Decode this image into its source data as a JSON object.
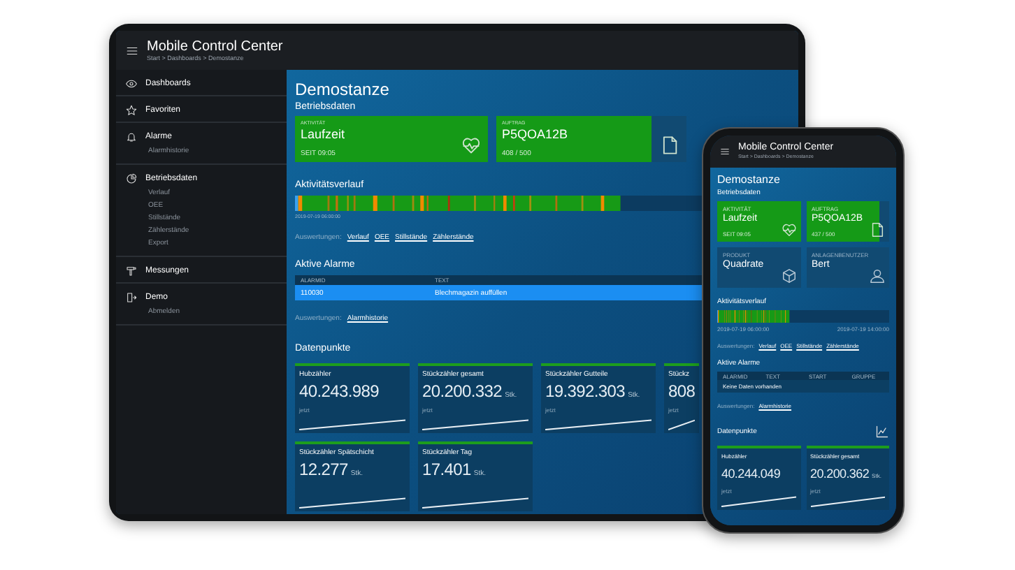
{
  "tablet": {
    "header": {
      "title": "Mobile Control Center",
      "breadcrumb": "Start > Dashboards > Demostanze"
    },
    "sidebar": {
      "items": [
        {
          "label": "Dashboards"
        },
        {
          "label": "Favoriten"
        },
        {
          "label": "Alarme",
          "children": [
            {
              "label": "Alarmhistorie"
            }
          ]
        },
        {
          "label": "Betriebsdaten",
          "children": [
            {
              "label": "Verlauf"
            },
            {
              "label": "OEE"
            },
            {
              "label": "Stillstände"
            },
            {
              "label": "Zählerstände"
            },
            {
              "label": "Export"
            }
          ]
        },
        {
          "label": "Messungen"
        },
        {
          "label": "Demo",
          "children": [
            {
              "label": "Abmelden"
            }
          ]
        }
      ]
    },
    "main": {
      "title": "Demostanze",
      "section": "Betriebsdaten",
      "cards": [
        {
          "kind": "status",
          "caption": "AKTIVITÄT",
          "value": "Laufzeit",
          "detail": "SEIT 09:05"
        },
        {
          "kind": "progress",
          "caption": "AUFTRAG",
          "value": "P5QOA12B",
          "detail": "408 / 500",
          "level": 0.816
        }
      ],
      "activity": {
        "title": "Aktivitätsverlauf",
        "dates": [
          "2019-07-19 06:00:00"
        ]
      },
      "activity_links": {
        "label": "Auswertungen:",
        "links": [
          "Verlauf",
          "OEE",
          "Stillstände",
          "Zählerstände"
        ]
      },
      "alarms": {
        "title": "Aktive Alarme",
        "columns": [
          "ALARMID",
          "TEXT"
        ],
        "rows": [
          {
            "cells": [
              "110030",
              "Blechmagazin auffüllen"
            ],
            "selected": true
          }
        ]
      },
      "alarm_links": {
        "label": "Auswertungen:",
        "links": [
          "Alarmhistorie"
        ]
      },
      "datapoints": {
        "title": "Datenpunkte",
        "items": [
          {
            "title": "Hubzähler",
            "value": "40.243.989",
            "time": "jetzt"
          },
          {
            "title": "Stückzähler gesamt",
            "value": "20.200.332",
            "unit": "Stk.",
            "time": "jetzt"
          },
          {
            "title": "Stückzähler Gutteile",
            "value": "19.392.303",
            "unit": "Stk.",
            "time": "jetzt"
          },
          {
            "title": "Stückz",
            "value": "808",
            "time": "jetzt"
          },
          {
            "title": "Stückzähler Spätschicht",
            "value": "12.277",
            "unit": "Stk."
          },
          {
            "title": "Stückzähler Tag",
            "value": "17.401",
            "unit": "Stk."
          }
        ]
      }
    }
  },
  "phone": {
    "header": {
      "title": "Mobile Control Center",
      "breadcrumb": "Start > Dashboards > Demostanze"
    },
    "main": {
      "title": "Demostanze",
      "section": "Betriebsdaten",
      "cards": [
        {
          "kind": "status",
          "caption": "AKTIVITÄT",
          "value": "Laufzeit",
          "detail": "SEIT 09:05"
        },
        {
          "kind": "progress",
          "caption": "AUFTRAG",
          "value": "P5QOA12B",
          "detail": "437 / 500",
          "level": 0.874
        },
        {
          "kind": "info",
          "caption": "PRODUKT",
          "value": "Quadrate"
        },
        {
          "kind": "info",
          "caption": "ANLAGENBENUTZER",
          "value": "Bert"
        }
      ],
      "activity": {
        "title": "Aktivitätsverlauf",
        "dates": [
          "2019-07-19 06:00:00",
          "2019-07-19 14:00:00"
        ]
      },
      "activity_links": {
        "label": "Auswertungen:",
        "links": [
          "Verlauf",
          "OEE",
          "Stillstände",
          "Zählerstände"
        ]
      },
      "alarms": {
        "title": "Aktive Alarme",
        "columns": [
          "ALARMID",
          "TEXT",
          "START",
          "GRUPPE"
        ],
        "empty_text": "Keine Daten vorhanden"
      },
      "alarm_links": {
        "label": "Auswertungen:",
        "links": [
          "Alarmhistorie"
        ]
      },
      "datapoints": {
        "title": "Datenpunkte",
        "items": [
          {
            "title": "Hubzähler",
            "value": "40.244.049",
            "time": "jetzt"
          },
          {
            "title": "Stückzähler gesamt",
            "value": "20.200.362",
            "unit": "Stk.",
            "time": "jetzt"
          }
        ]
      }
    }
  }
}
